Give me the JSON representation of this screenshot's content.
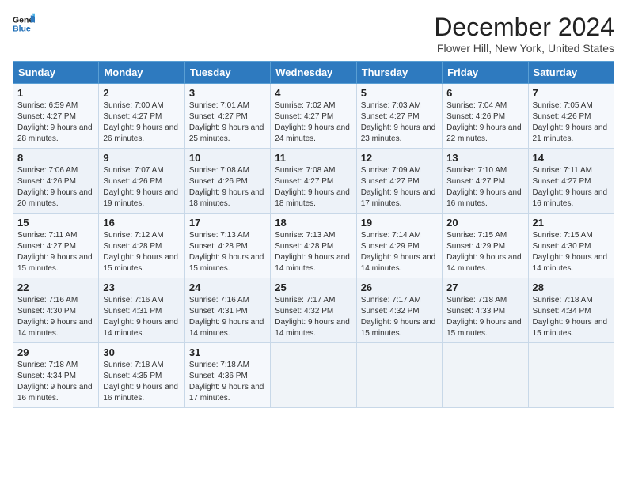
{
  "header": {
    "logo_line1": "General",
    "logo_line2": "Blue",
    "month_title": "December 2024",
    "location": "Flower Hill, New York, United States"
  },
  "days_of_week": [
    "Sunday",
    "Monday",
    "Tuesday",
    "Wednesday",
    "Thursday",
    "Friday",
    "Saturday"
  ],
  "weeks": [
    [
      {
        "day": "1",
        "sunrise": "6:59 AM",
        "sunset": "4:27 PM",
        "daylight": "9 hours and 28 minutes."
      },
      {
        "day": "2",
        "sunrise": "7:00 AM",
        "sunset": "4:27 PM",
        "daylight": "9 hours and 26 minutes."
      },
      {
        "day": "3",
        "sunrise": "7:01 AM",
        "sunset": "4:27 PM",
        "daylight": "9 hours and 25 minutes."
      },
      {
        "day": "4",
        "sunrise": "7:02 AM",
        "sunset": "4:27 PM",
        "daylight": "9 hours and 24 minutes."
      },
      {
        "day": "5",
        "sunrise": "7:03 AM",
        "sunset": "4:27 PM",
        "daylight": "9 hours and 23 minutes."
      },
      {
        "day": "6",
        "sunrise": "7:04 AM",
        "sunset": "4:26 PM",
        "daylight": "9 hours and 22 minutes."
      },
      {
        "day": "7",
        "sunrise": "7:05 AM",
        "sunset": "4:26 PM",
        "daylight": "9 hours and 21 minutes."
      }
    ],
    [
      {
        "day": "8",
        "sunrise": "7:06 AM",
        "sunset": "4:26 PM",
        "daylight": "9 hours and 20 minutes."
      },
      {
        "day": "9",
        "sunrise": "7:07 AM",
        "sunset": "4:26 PM",
        "daylight": "9 hours and 19 minutes."
      },
      {
        "day": "10",
        "sunrise": "7:08 AM",
        "sunset": "4:26 PM",
        "daylight": "9 hours and 18 minutes."
      },
      {
        "day": "11",
        "sunrise": "7:08 AM",
        "sunset": "4:27 PM",
        "daylight": "9 hours and 18 minutes."
      },
      {
        "day": "12",
        "sunrise": "7:09 AM",
        "sunset": "4:27 PM",
        "daylight": "9 hours and 17 minutes."
      },
      {
        "day": "13",
        "sunrise": "7:10 AM",
        "sunset": "4:27 PM",
        "daylight": "9 hours and 16 minutes."
      },
      {
        "day": "14",
        "sunrise": "7:11 AM",
        "sunset": "4:27 PM",
        "daylight": "9 hours and 16 minutes."
      }
    ],
    [
      {
        "day": "15",
        "sunrise": "7:11 AM",
        "sunset": "4:27 PM",
        "daylight": "9 hours and 15 minutes."
      },
      {
        "day": "16",
        "sunrise": "7:12 AM",
        "sunset": "4:28 PM",
        "daylight": "9 hours and 15 minutes."
      },
      {
        "day": "17",
        "sunrise": "7:13 AM",
        "sunset": "4:28 PM",
        "daylight": "9 hours and 15 minutes."
      },
      {
        "day": "18",
        "sunrise": "7:13 AM",
        "sunset": "4:28 PM",
        "daylight": "9 hours and 14 minutes."
      },
      {
        "day": "19",
        "sunrise": "7:14 AM",
        "sunset": "4:29 PM",
        "daylight": "9 hours and 14 minutes."
      },
      {
        "day": "20",
        "sunrise": "7:15 AM",
        "sunset": "4:29 PM",
        "daylight": "9 hours and 14 minutes."
      },
      {
        "day": "21",
        "sunrise": "7:15 AM",
        "sunset": "4:30 PM",
        "daylight": "9 hours and 14 minutes."
      }
    ],
    [
      {
        "day": "22",
        "sunrise": "7:16 AM",
        "sunset": "4:30 PM",
        "daylight": "9 hours and 14 minutes."
      },
      {
        "day": "23",
        "sunrise": "7:16 AM",
        "sunset": "4:31 PM",
        "daylight": "9 hours and 14 minutes."
      },
      {
        "day": "24",
        "sunrise": "7:16 AM",
        "sunset": "4:31 PM",
        "daylight": "9 hours and 14 minutes."
      },
      {
        "day": "25",
        "sunrise": "7:17 AM",
        "sunset": "4:32 PM",
        "daylight": "9 hours and 14 minutes."
      },
      {
        "day": "26",
        "sunrise": "7:17 AM",
        "sunset": "4:32 PM",
        "daylight": "9 hours and 15 minutes."
      },
      {
        "day": "27",
        "sunrise": "7:18 AM",
        "sunset": "4:33 PM",
        "daylight": "9 hours and 15 minutes."
      },
      {
        "day": "28",
        "sunrise": "7:18 AM",
        "sunset": "4:34 PM",
        "daylight": "9 hours and 15 minutes."
      }
    ],
    [
      {
        "day": "29",
        "sunrise": "7:18 AM",
        "sunset": "4:34 PM",
        "daylight": "9 hours and 16 minutes."
      },
      {
        "day": "30",
        "sunrise": "7:18 AM",
        "sunset": "4:35 PM",
        "daylight": "9 hours and 16 minutes."
      },
      {
        "day": "31",
        "sunrise": "7:18 AM",
        "sunset": "4:36 PM",
        "daylight": "9 hours and 17 minutes."
      },
      null,
      null,
      null,
      null
    ]
  ],
  "labels": {
    "sunrise": "Sunrise:",
    "sunset": "Sunset:",
    "daylight": "Daylight:"
  }
}
